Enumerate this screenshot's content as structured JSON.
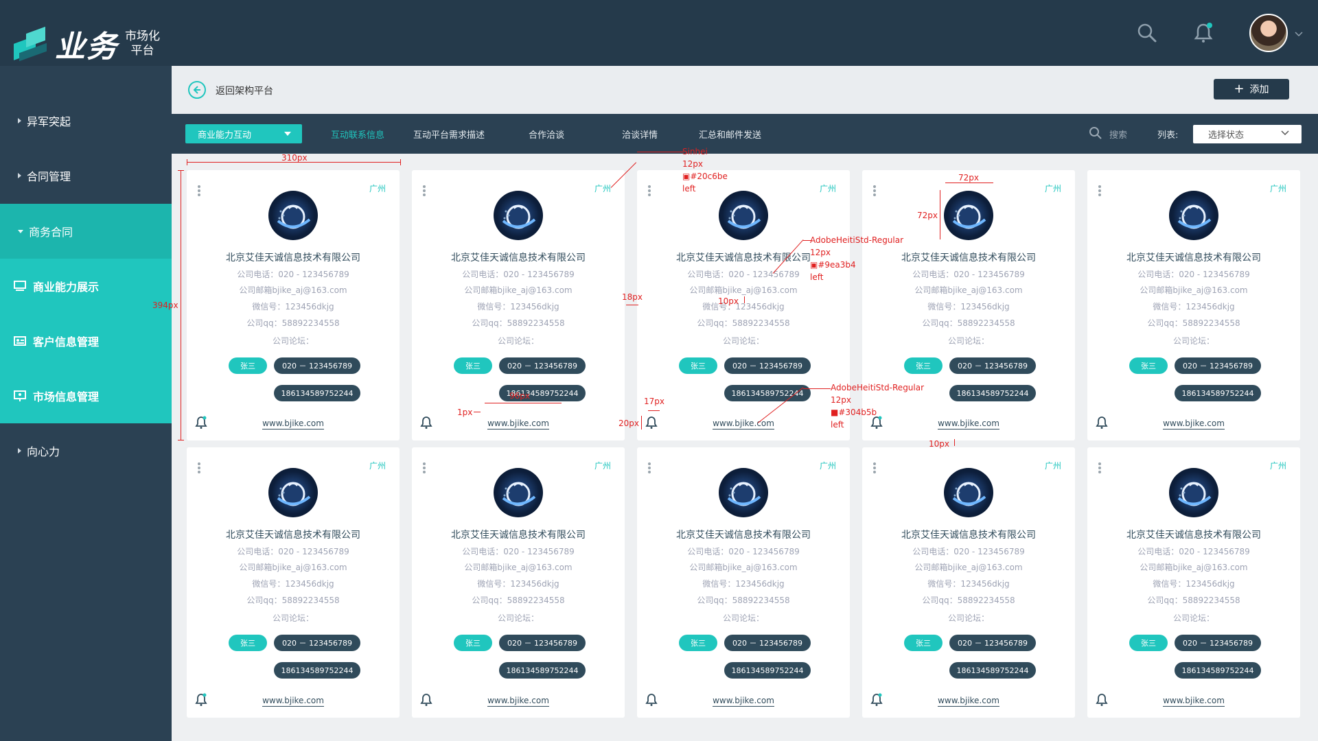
{
  "app": {
    "logo_main": "业务",
    "logo_sub_1": "市场化",
    "logo_sub_2": "平台"
  },
  "header": {
    "back_label": "返回架构平台",
    "add_label": "添加"
  },
  "sidebar": {
    "items": [
      {
        "label": "异军突起"
      },
      {
        "label": "合同管理"
      },
      {
        "label": "商务合同"
      },
      {
        "label": "商业能力展示"
      },
      {
        "label": "客户信息管理"
      },
      {
        "label": "市场信息管理"
      },
      {
        "label": "向心力"
      }
    ]
  },
  "toolbar": {
    "dropdown_value": "商业能力互动",
    "tabs": [
      {
        "label": "互动联系信息"
      },
      {
        "label": "互动平台需求描述"
      },
      {
        "label": "合作洽谈"
      },
      {
        "label": "洽谈详情"
      },
      {
        "label": "汇总和邮件发送"
      }
    ],
    "search_label": "搜索",
    "list_label": "列表:",
    "select_value": "选择状态"
  },
  "card": {
    "city": "广州",
    "company": "北京艾佳天诚信息技术有限公司",
    "phone": "公司电话：020 - 123456789",
    "email": "公司邮箱bjike_aj@163.com",
    "wechat": "微信号：123456dkjg",
    "qq": "公司qq：58892234558",
    "forum": "公司论坛：",
    "contact": "张三",
    "tel": "020 － 123456789",
    "mobile": "186134589752244",
    "site": "www.bjike.com"
  },
  "annotations": {
    "w310": "310px",
    "h394": "394px",
    "a_city_1": "Sinhei",
    "a_city_2": "12px",
    "a_city_3": "▣#20c6be",
    "a_city_4": "left",
    "w72": "72px",
    "h72": "72px",
    "f1_1": "AdobeHeitiStd-Regular",
    "f1_2": "12px",
    "f1_3": "▣#9ea3b4",
    "f1_4": "left",
    "g18": "18px",
    "g10a": "10px",
    "f2_1": "AdobeHeitiStd-Regular",
    "f2_2": "12px",
    "f2_3": "■#304b5b",
    "f2_4": "left",
    "g17": "17px",
    "g20": "20px",
    "g1": "1px",
    "w_mobile": "96px",
    "g10b": "10px"
  }
}
